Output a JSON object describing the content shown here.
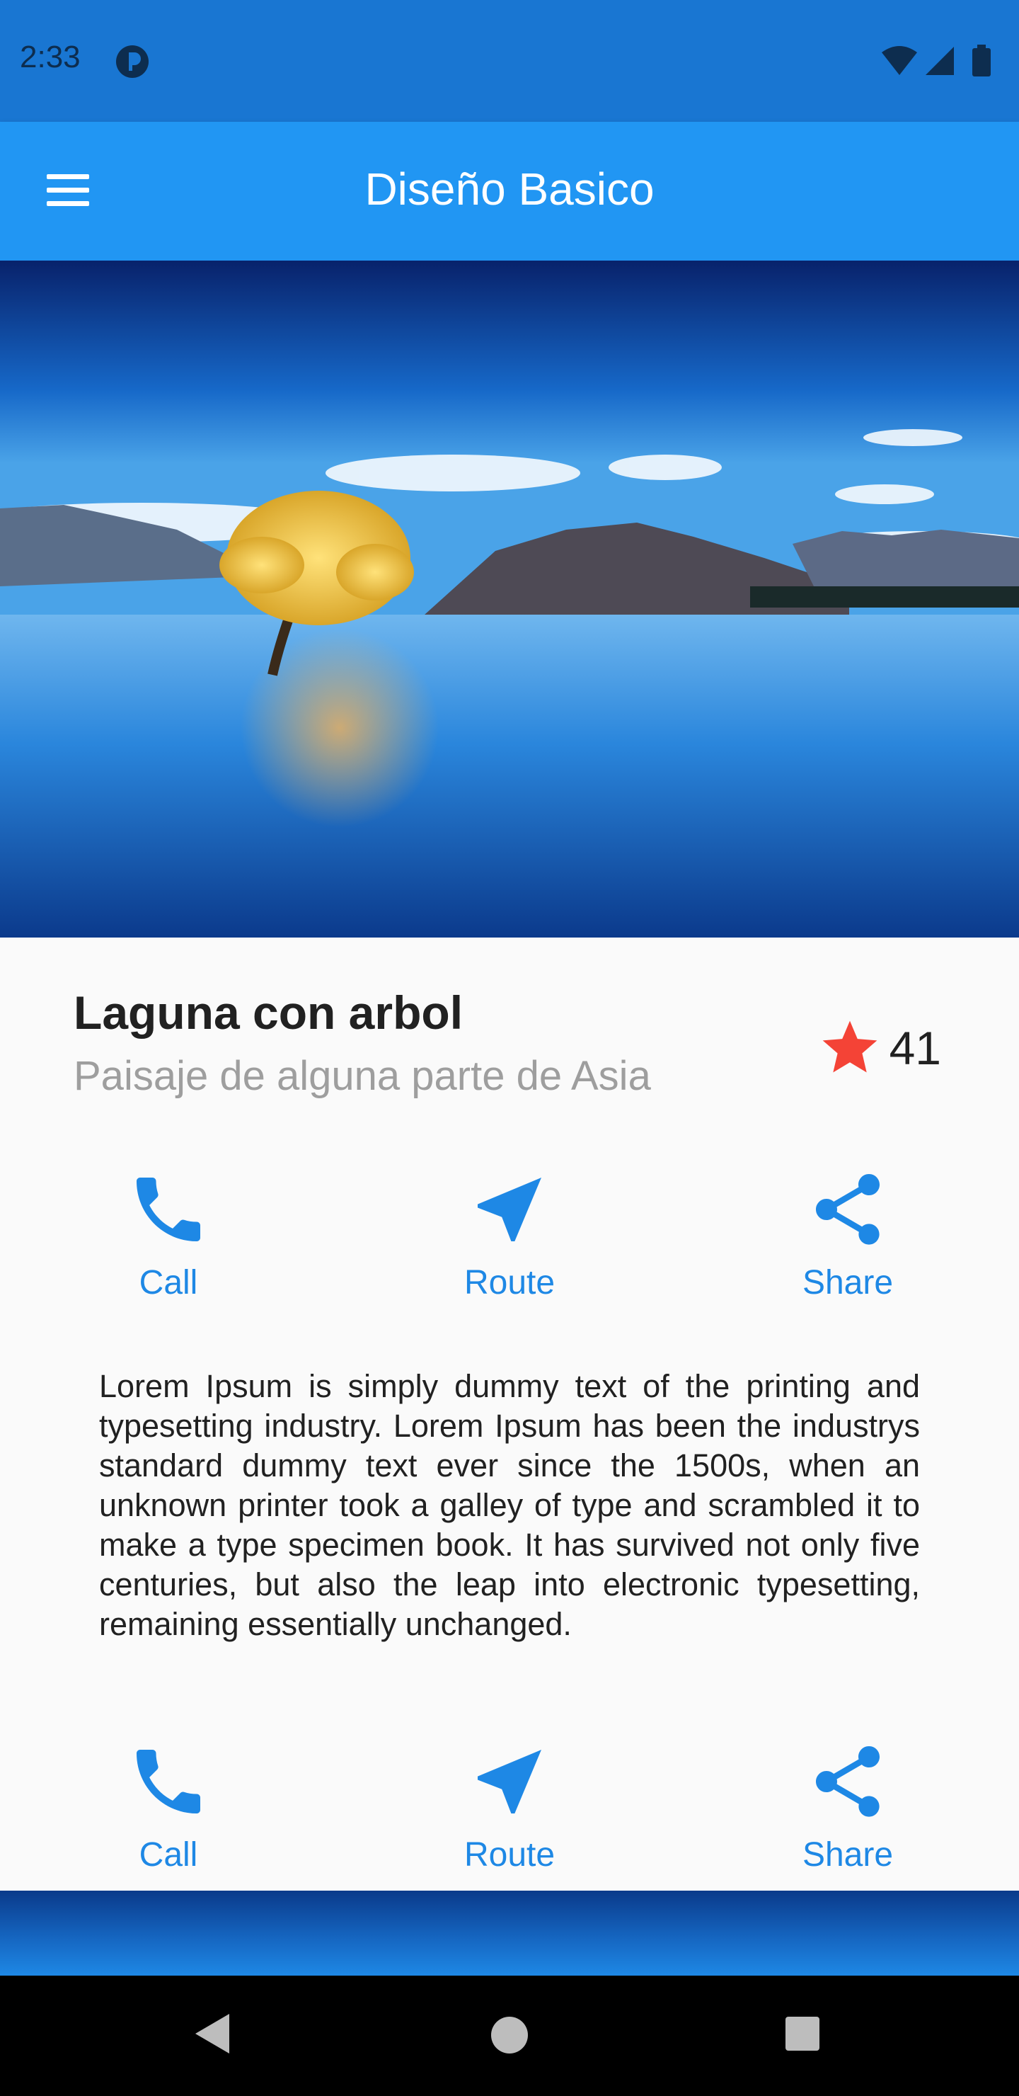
{
  "status_bar": {
    "time": "2:33"
  },
  "app_bar": {
    "title": "Diseño Basico"
  },
  "card": {
    "title": "Laguna con arbol",
    "subtitle": "Paisaje de alguna parte de Asia",
    "rating": "41"
  },
  "actions_top": [
    {
      "label": "Call",
      "icon": "phone-icon"
    },
    {
      "label": "Route",
      "icon": "navigation-icon"
    },
    {
      "label": "Share",
      "icon": "share-icon"
    }
  ],
  "description": "Lorem Ipsum is simply dummy text of the printing and typesetting industry. Lorem Ipsum has been the industrys standard dummy text ever since the 1500s, when an unknown printer took a galley of type and scrambled it to make a type specimen book. It has survived not only five centuries, but also the leap into electronic typesetting, remaining essentially unchanged.",
  "actions_bottom": [
    {
      "label": "Call",
      "icon": "phone-icon"
    },
    {
      "label": "Route",
      "icon": "navigation-icon"
    },
    {
      "label": "Share",
      "icon": "share-icon"
    }
  ],
  "colors": {
    "primary": "#2196f3",
    "status_bar": "#1976d2",
    "accent_text": "#1e88e5",
    "star": "#f44336"
  },
  "nav_bar": {
    "icons": [
      "back-icon",
      "home-icon",
      "recents-icon"
    ]
  }
}
